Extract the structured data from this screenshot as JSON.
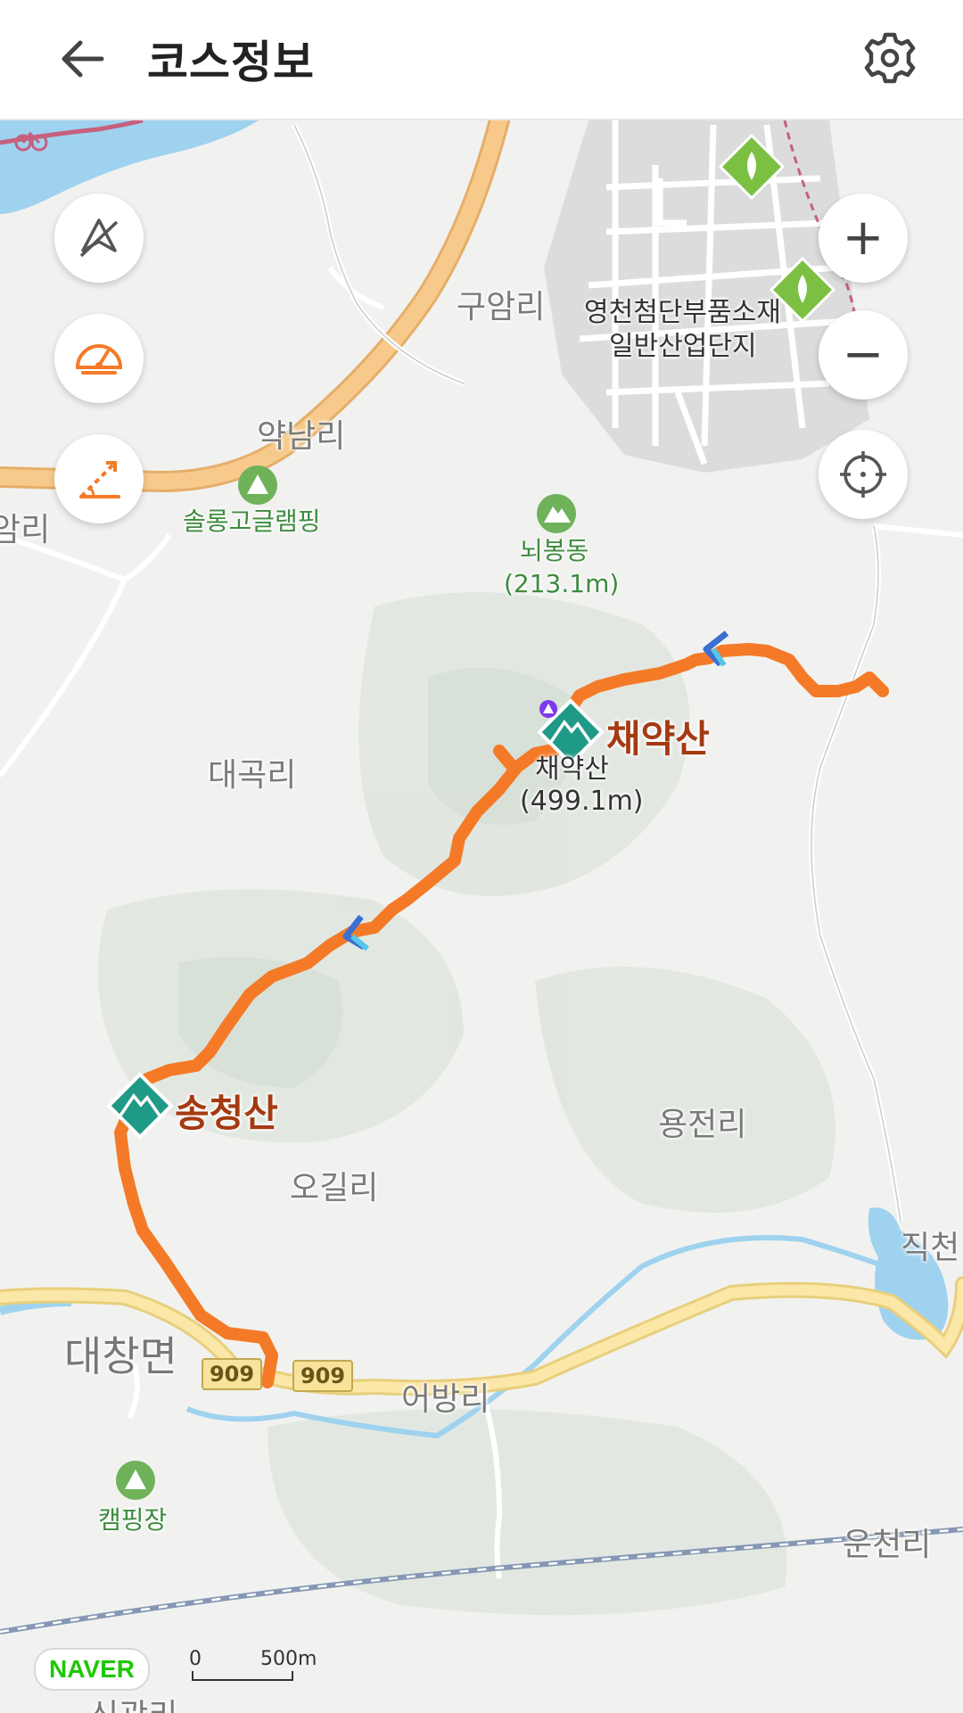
{
  "header": {
    "title": "코스정보",
    "back_icon": "arrow-left-icon",
    "settings_icon": "gear-icon"
  },
  "map_controls": {
    "left": [
      {
        "icon": "compass-off-icon"
      },
      {
        "icon": "speedometer-icon"
      },
      {
        "icon": "elevation-icon"
      }
    ],
    "zoom_in": "+",
    "zoom_out": "−",
    "locate_icon": "crosshair-icon"
  },
  "places": {
    "guam_ri": "구암리",
    "industrial_1": "영천첨단부품소재",
    "industrial_2": "일반산업단지",
    "yaknam_ri": "약남리",
    "camping_solong": "솔롱고글램핑",
    "ri_left": "암리",
    "peak_small_name": "뇌봉동",
    "peak_small_height": "(213.1m)",
    "daegok_ri": "대곡리",
    "chaeyaksan_sub": "채약산",
    "chaeyaksan_height": "(499.1m)",
    "yongjeon_ri": "용전리",
    "ogil_ri": "오길리",
    "jikcheon": "직천",
    "daechang_myeon": "대창면",
    "eobang_ri": "어방리",
    "camping_site": "캠핑장",
    "uncheon_ri": "운천리",
    "singwan_ri": "신광리"
  },
  "peaks": {
    "chaeyaksan": "채약산",
    "songcheongsan": "송청산"
  },
  "roads": {
    "road_a": "909",
    "road_b": "909"
  },
  "colors": {
    "route": "#f47a28",
    "peak_marker": "#1f9a87",
    "water": "#9fd2ef",
    "highway": "#f5c27a",
    "local_road": "#fae3a0"
  },
  "footer": {
    "logo": "NAVER",
    "scale_zero": "0",
    "scale_value": "500m"
  }
}
